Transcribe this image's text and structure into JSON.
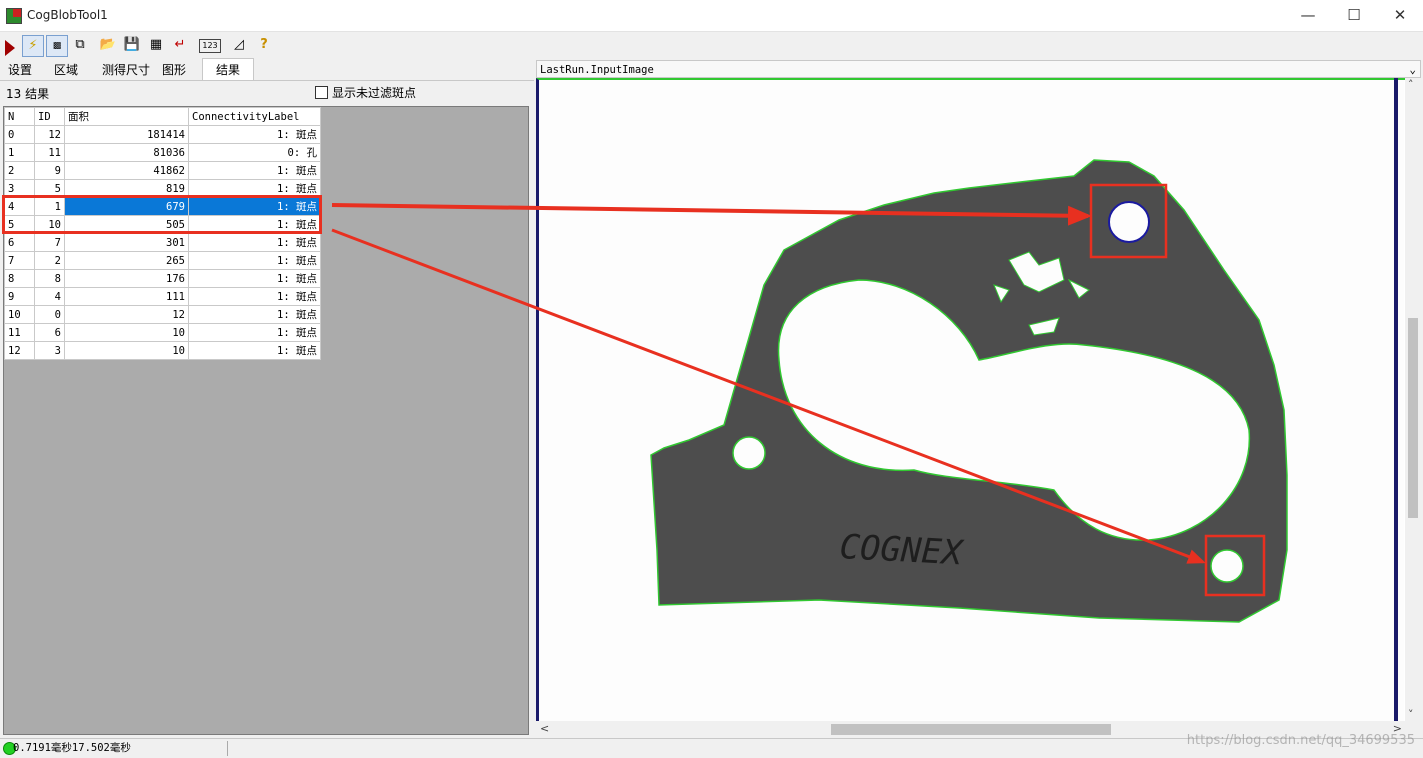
{
  "window": {
    "title": "CogBlobTool1"
  },
  "tabs": [
    {
      "label": "设置"
    },
    {
      "label": "区域"
    },
    {
      "label": "测得尺寸"
    },
    {
      "label": "图形"
    },
    {
      "label": "结果"
    }
  ],
  "results": {
    "count_label": "13 结果",
    "show_unfiltered_label": "显示未过滤斑点",
    "columns": [
      "N",
      "ID",
      "面积",
      "ConnectivityLabel"
    ],
    "rows": [
      [
        "0",
        "12",
        "181414",
        "1: 斑点"
      ],
      [
        "1",
        "11",
        "81036",
        "0: 孔"
      ],
      [
        "2",
        "9",
        "41862",
        "1: 斑点"
      ],
      [
        "3",
        "5",
        "819",
        "1: 斑点"
      ],
      [
        "4",
        "1",
        "679",
        "1: 斑点"
      ],
      [
        "5",
        "10",
        "505",
        "1: 斑点"
      ],
      [
        "6",
        "7",
        "301",
        "1: 斑点"
      ],
      [
        "7",
        "2",
        "265",
        "1: 斑点"
      ],
      [
        "8",
        "8",
        "176",
        "1: 斑点"
      ],
      [
        "9",
        "4",
        "111",
        "1: 斑点"
      ],
      [
        "10",
        "0",
        "12",
        "1: 斑点"
      ],
      [
        "11",
        "6",
        "10",
        "1: 斑点"
      ],
      [
        "12",
        "3",
        "10",
        "1: 斑点"
      ]
    ],
    "selected_row": 4
  },
  "image_view": {
    "header": "LastRun.InputImage",
    "part_text": "COGNEX"
  },
  "status": {
    "text": "0.7191毫秒17.502毫秒"
  },
  "watermark": "https://blog.csdn.net/qq_34699535",
  "colors": {
    "selection": "#0a78d7",
    "annotation": "#e83020",
    "blob_outline": "#31c831",
    "hole_outline": "#1a1aa0"
  }
}
